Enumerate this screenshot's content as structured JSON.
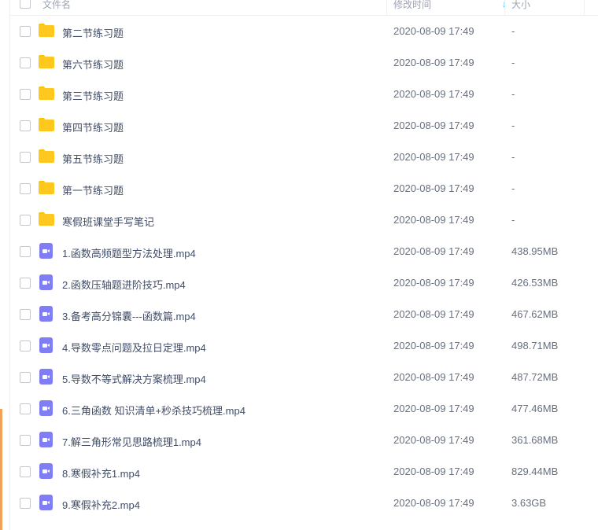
{
  "header": {
    "name": "文件名",
    "modified": "修改时间",
    "size": "大小",
    "sort_arrow": "↓"
  },
  "rows": [
    {
      "name": "第二节练习题",
      "time": "2020-08-09 17:49",
      "size": "-",
      "icon": "folder-icon"
    },
    {
      "name": "第六节练习题",
      "time": "2020-08-09 17:49",
      "size": "-",
      "icon": "folder-icon"
    },
    {
      "name": "第三节练习题",
      "time": "2020-08-09 17:49",
      "size": "-",
      "icon": "folder-icon"
    },
    {
      "name": "第四节练习题",
      "time": "2020-08-09 17:49",
      "size": "-",
      "icon": "folder-icon"
    },
    {
      "name": "第五节练习题",
      "time": "2020-08-09 17:49",
      "size": "-",
      "icon": "folder-icon"
    },
    {
      "name": "第一节练习题",
      "time": "2020-08-09 17:49",
      "size": "-",
      "icon": "folder-icon"
    },
    {
      "name": "寒假班课堂手写笔记",
      "time": "2020-08-09 17:49",
      "size": "-",
      "icon": "folder-icon"
    },
    {
      "name": "1.函数高频题型方法处理.mp4",
      "time": "2020-08-09 17:49",
      "size": "438.95MB",
      "icon": "video-file-icon"
    },
    {
      "name": "2.函数压轴题进阶技巧.mp4",
      "time": "2020-08-09 17:49",
      "size": "426.53MB",
      "icon": "video-file-icon"
    },
    {
      "name": "3.备考高分锦囊---函数篇.mp4",
      "time": "2020-08-09 17:49",
      "size": "467.62MB",
      "icon": "video-file-icon"
    },
    {
      "name": "4.导数零点问题及拉日定理.mp4",
      "time": "2020-08-09 17:49",
      "size": "498.71MB",
      "icon": "video-file-icon"
    },
    {
      "name": "5.导数不等式解决方案梳理.mp4",
      "time": "2020-08-09 17:49",
      "size": "487.72MB",
      "icon": "video-file-icon"
    },
    {
      "name": "6.三角函数 知识清单+秒杀技巧梳理.mp4",
      "time": "2020-08-09 17:49",
      "size": "477.46MB",
      "icon": "video-file-icon"
    },
    {
      "name": "7.解三角形常见思路梳理1.mp4",
      "time": "2020-08-09 17:49",
      "size": "361.68MB",
      "icon": "video-file-icon"
    },
    {
      "name": "8.寒假补充1.mp4",
      "time": "2020-08-09 17:49",
      "size": "829.44MB",
      "icon": "video-file-icon"
    },
    {
      "name": "9.寒假补充2.mp4",
      "time": "2020-08-09 17:49",
      "size": "3.63GB",
      "icon": "video-file-icon"
    }
  ]
}
